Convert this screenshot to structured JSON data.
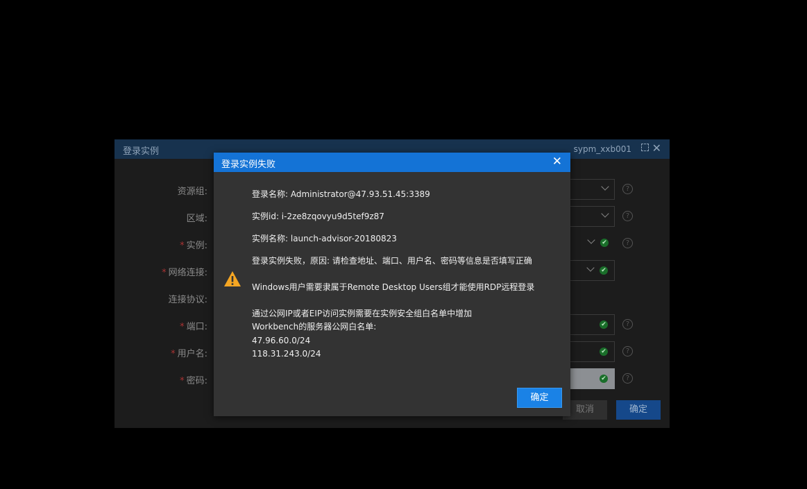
{
  "background_dialog": {
    "title": "登录实例",
    "user": "sypm_xxb001",
    "fields": [
      {
        "label": "资源组:",
        "required": false
      },
      {
        "label": "区域:",
        "required": false
      },
      {
        "label": "实例:",
        "required": true
      },
      {
        "label": "网络连接:",
        "required": true
      },
      {
        "label": "连接协议:",
        "required": false
      },
      {
        "label": "端口:",
        "required": true
      },
      {
        "label": "用户名:",
        "required": true
      },
      {
        "label": "密码:",
        "required": true
      }
    ],
    "required_mark": "*",
    "help_glyph": "?",
    "check_glyph": "✔",
    "cancel_label": "取消",
    "ok_label": "确定"
  },
  "modal": {
    "title": "登录实例失败",
    "close_glyph": "✕",
    "lines": [
      "登录名称: Administrator@47.93.51.45:3389",
      "实例id: i-2ze8zqovyu9d5tef9z87",
      "实例名称: launch-advisor-20180823",
      "登录实例失败，原因: 请检查地址、端口、用户名、密码等信息是否填写正确",
      "Windows用户需要隶属于Remote Desktop Users组才能使用RDP远程登录",
      "通过公网IP或者EIP访问实例需要在实例安全组白名单中增加",
      "Workbench的服务器公网白名单:",
      "47.96.60.0/24",
      "118.31.243.0/24"
    ],
    "ok_label": "确定"
  },
  "colors": {
    "modal_header": "#1473d6",
    "modal_body": "#333333",
    "warning": "#f5a623"
  }
}
